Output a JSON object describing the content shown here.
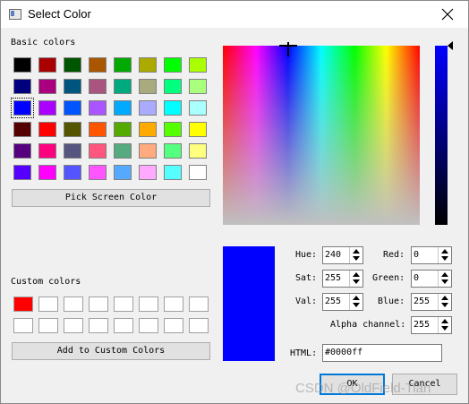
{
  "window": {
    "title": "Select Color",
    "icon": "window-app-icon",
    "close_icon": "close-icon"
  },
  "basic_colors": {
    "label": "Basic colors",
    "selected_index": 16,
    "rows": [
      [
        "#000000",
        "#aa0000",
        "#005500",
        "#aa5500",
        "#00aa00",
        "#aaaa00",
        "#00ff00",
        "#aaff00"
      ],
      [
        "#00007f",
        "#aa007f",
        "#00557f",
        "#aa557f",
        "#00aa7f",
        "#aaaa7f",
        "#00ff7f",
        "#aaff7f"
      ],
      [
        "#0000ff",
        "#aa00ff",
        "#0055ff",
        "#aa55ff",
        "#00aaff",
        "#aaaaff",
        "#00ffff",
        "#aaffff"
      ],
      [
        "#550000",
        "#ff0000",
        "#555500",
        "#ff5500",
        "#55aa00",
        "#ffaa00",
        "#55ff00",
        "#ffff00"
      ],
      [
        "#55007f",
        "#ff007f",
        "#55557f",
        "#ff557f",
        "#55aa7f",
        "#ffaa7f",
        "#55ff7f",
        "#ffff7f"
      ],
      [
        "#5500ff",
        "#ff00ff",
        "#5555ff",
        "#ff55ff",
        "#55aaff",
        "#ffaaff",
        "#55ffff",
        "#ffffff"
      ]
    ]
  },
  "pick_screen_label": "Pick Screen Color",
  "custom_colors": {
    "label": "Custom colors",
    "rows": [
      [
        "#ff0000",
        "#ffffff",
        "#ffffff",
        "#ffffff",
        "#ffffff",
        "#ffffff",
        "#ffffff",
        "#ffffff"
      ],
      [
        "#ffffff",
        "#ffffff",
        "#ffffff",
        "#ffffff",
        "#ffffff",
        "#ffffff",
        "#ffffff",
        "#ffffff"
      ]
    ]
  },
  "add_custom_label": "Add to Custom Colors",
  "current_color": "#0000ff",
  "fields": {
    "hue": {
      "label": "Hue:",
      "value": "240"
    },
    "sat": {
      "label": "Sat:",
      "value": "255"
    },
    "val": {
      "label": "Val:",
      "value": "255"
    },
    "red": {
      "label": "Red:",
      "value": "0"
    },
    "green": {
      "label": "Green:",
      "value": "0"
    },
    "blue": {
      "label": "Blue:",
      "value": "255"
    },
    "alpha": {
      "label": "Alpha channel:",
      "value": "255"
    }
  },
  "html": {
    "label": "HTML:",
    "value": "#0000ff"
  },
  "buttons": {
    "ok": "OK",
    "cancel": "Cancel"
  },
  "watermark": "CSDN @OldField-Tian"
}
